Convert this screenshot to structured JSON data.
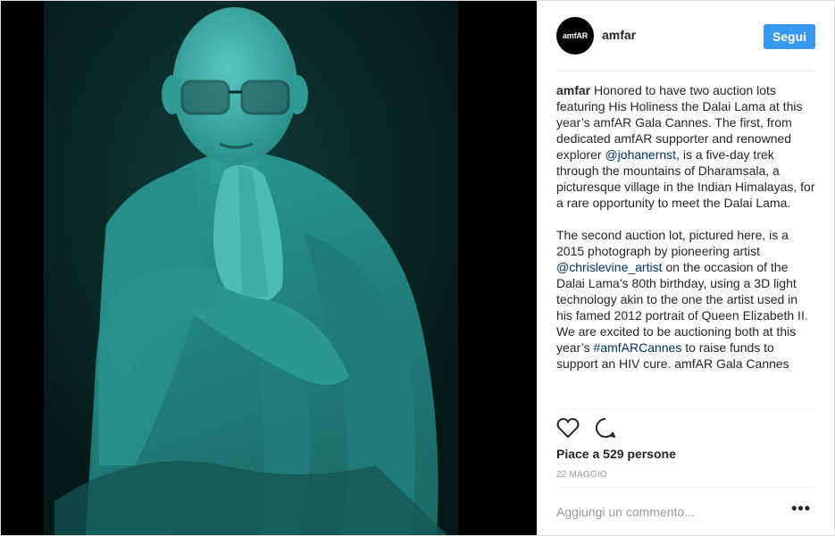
{
  "post": {
    "image_alt": "Portrait of the Dalai Lama in teal tone",
    "colors": {
      "photo_tint": "#2fa6a0",
      "photo_dark": "#0b2f2d",
      "photo_bg": "#000000"
    }
  },
  "header": {
    "avatar_text": "amfAR",
    "username": "amfar",
    "follow_label": "Segui",
    "follow_color": "#3897f0"
  },
  "caption": {
    "username": "amfar",
    "p1_a": " Honored to have two auction lots featuring His Holiness the Dalai Lama at this year’s amfAR Gala Cannes. The first, from dedicated amfAR supporter and renowned explorer ",
    "p1_mention": "@johanernst",
    "p1_b": ", is a five-day trek through the mountains of Dharamsala, a picturesque village in the Indian Himalayas, for a rare opportunity to meet the Dalai Lama.",
    "p2_a": "The second auction lot, pictured here, is a 2015 photograph by pioneering artist ",
    "p2_mention": "@chrislevine_artist",
    "p2_b": " on the occasion of the Dalai Lama’s 80th birthday, using a 3D light technology akin to the one the artist used in his famed 2012 portrait of Queen Elizabeth II.",
    "p3_a": "We are excited to be auctioning both at this year’s ",
    "p3_hashtag": "#amfARCannes",
    "p3_b": " to raise funds to support an HIV cure. amfAR Gala Cannes"
  },
  "actions": {
    "like_icon": "heart-icon",
    "comment_icon": "comment-bubble-icon"
  },
  "likes_text": "Piace a 529 persone",
  "date_text": "22 MAGGIO",
  "comment": {
    "placeholder": "Aggiungi un commento...",
    "more_label": "•••"
  }
}
